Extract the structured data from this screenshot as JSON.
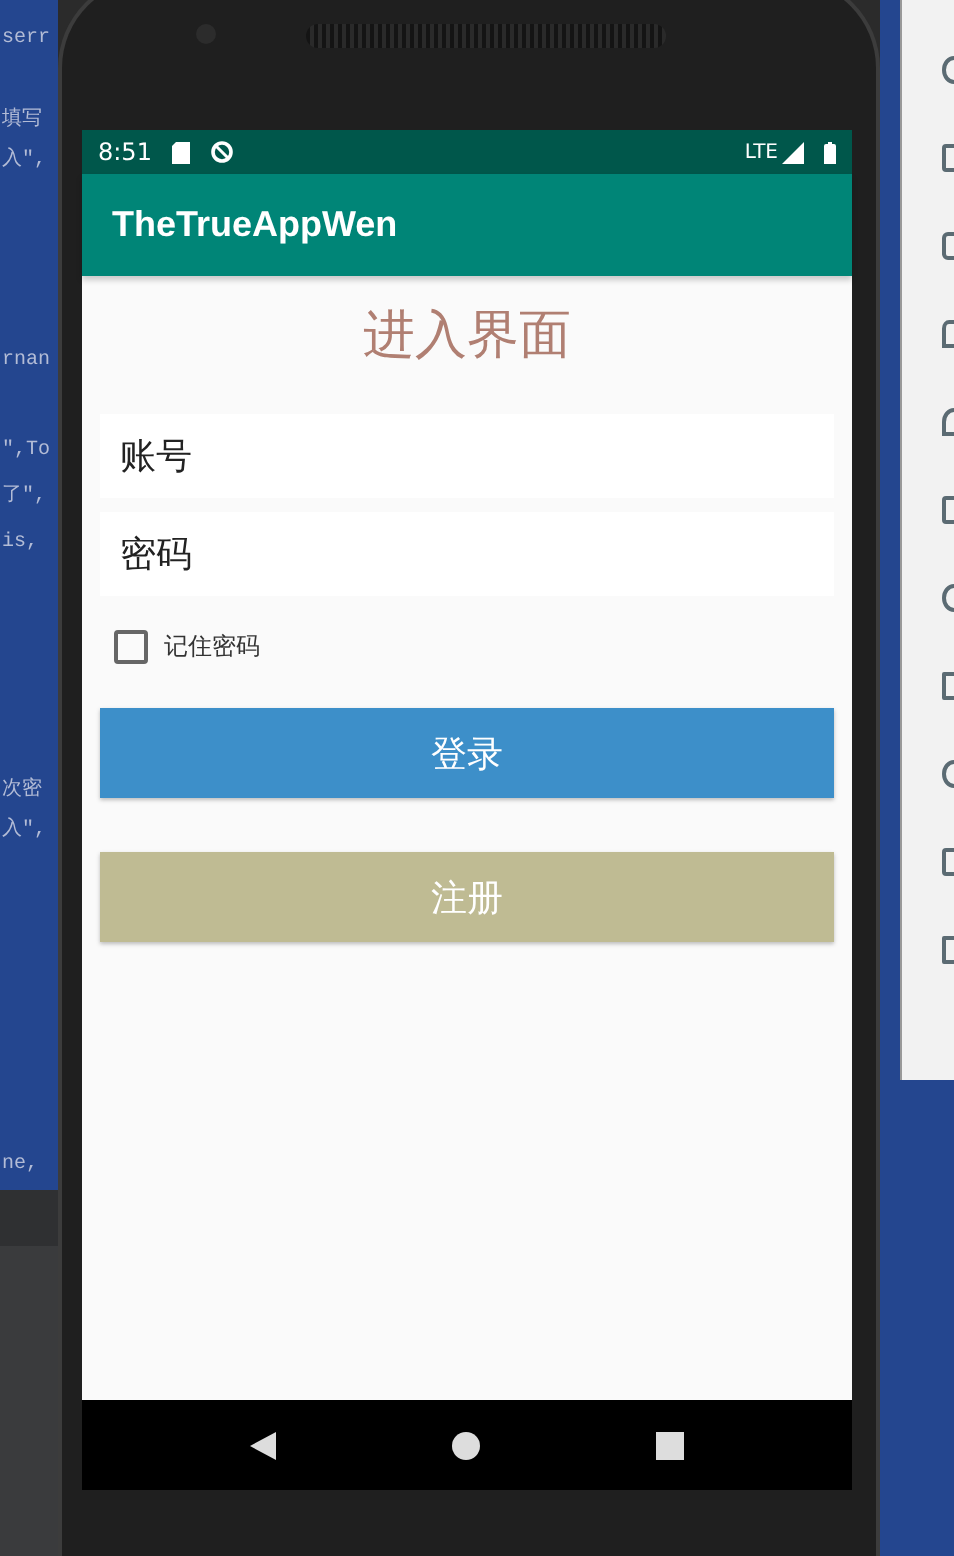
{
  "ide_code_fragments": [
    {
      "text": "serr"
    },
    {
      "text": "填写"
    },
    {
      "text": "入\","
    },
    {
      "text": "rnan"
    },
    {
      "text": "\",To"
    },
    {
      "text": "了\","
    },
    {
      "text": "is,"
    },
    {
      "text": "次密"
    },
    {
      "text": "入\","
    },
    {
      "text": "ne,"
    }
  ],
  "status_bar": {
    "time": "8:51",
    "network": "LTE"
  },
  "app_bar": {
    "title": "TheTrueAppWen"
  },
  "page_title": "进入界面",
  "fields": [
    {
      "placeholder": "账号"
    },
    {
      "placeholder": "密码"
    }
  ],
  "remember_password": {
    "label": "记住密码",
    "checked": false
  },
  "buttons": [
    {
      "label": "登录",
      "kind": "primary"
    },
    {
      "label": "注册",
      "kind": "secondary"
    }
  ]
}
